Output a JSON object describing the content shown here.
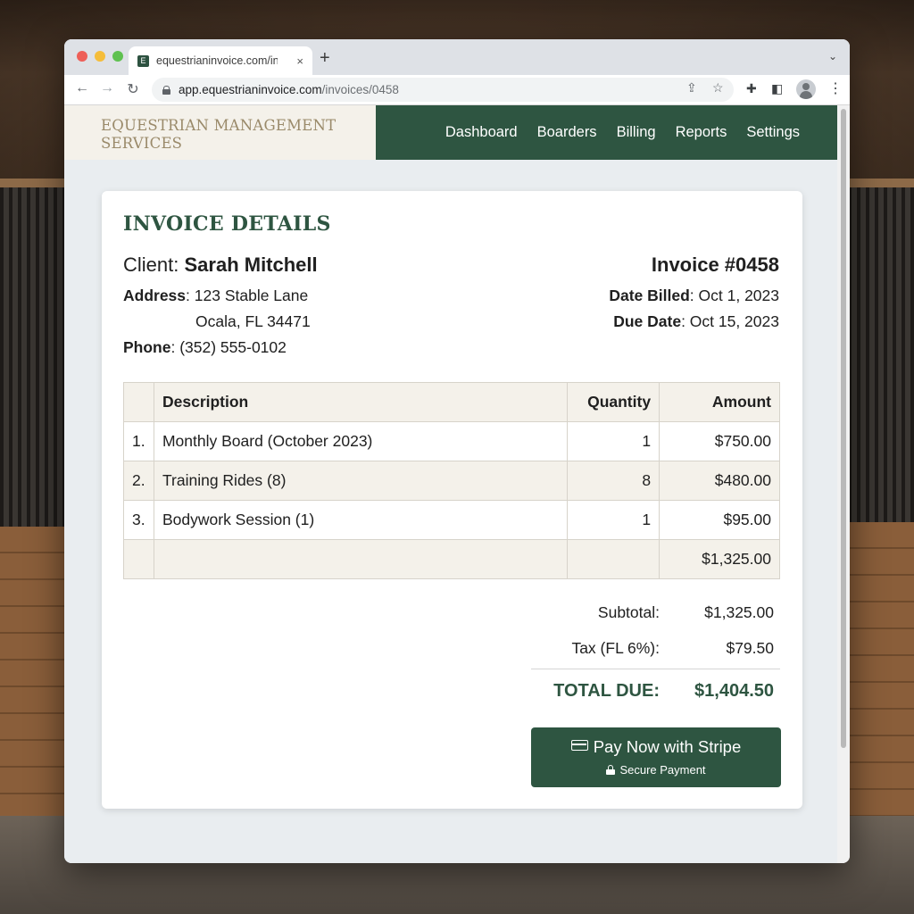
{
  "browser": {
    "tab_title": "equestrianinvoice.com/invc",
    "tab_favicon": "E",
    "tab_close": "×",
    "new_tab": "+",
    "url_host": "app.equestrianinvoice.com",
    "url_path": "/invoices/0458"
  },
  "site": {
    "brand_line1": "EQUESTRIAN MANAGEMENT",
    "brand_line2": "SERVICES",
    "nav": [
      "Dashboard",
      "Boarders",
      "Billing",
      "Reports",
      "Settings"
    ]
  },
  "invoice": {
    "title": "INVOICE DETAILS",
    "client_label": "Client:",
    "client_name": "Sarah Mitchell",
    "address_label": "Address",
    "address_line1": ": 123 Stable Lane",
    "address_line2": "Ocala, FL 34471",
    "phone_label": "Phone",
    "phone_value": ": (352) 555-0102",
    "number": "Invoice #0458",
    "date_billed_label": "Date Billed",
    "date_billed_value": ": Oct 1, 2023",
    "due_date_label": "Due Date",
    "due_date_value": ": Oct 15, 2023"
  },
  "table": {
    "headers": {
      "index": "",
      "description": "Description",
      "quantity": "Quantity",
      "amount": "Amount"
    },
    "rows": [
      {
        "index": "1.",
        "description": "Monthly Board (October 2023)",
        "quantity": "1",
        "amount": "$750.00"
      },
      {
        "index": "2.",
        "description": "Training Rides (8)",
        "quantity": "8",
        "amount": "$480.00"
      },
      {
        "index": "3.",
        "description": "Bodywork Session (1)",
        "quantity": "1",
        "amount": "$95.00"
      }
    ],
    "footer_total": "$1,325.00"
  },
  "summary": {
    "subtotal_label": "Subtotal:",
    "subtotal_value": "$1,325.00",
    "tax_label": "Tax (FL 6%):",
    "tax_value": "$79.50",
    "total_label": "TOTAL DUE:",
    "total_value": "$1,404.50"
  },
  "payment": {
    "button_label": "Pay Now with Stripe",
    "sub_label": "Secure Payment"
  },
  "colors": {
    "brand_green": "#2e5541",
    "cream": "#f4f1ea",
    "brand_text": "#9a8a6a"
  }
}
